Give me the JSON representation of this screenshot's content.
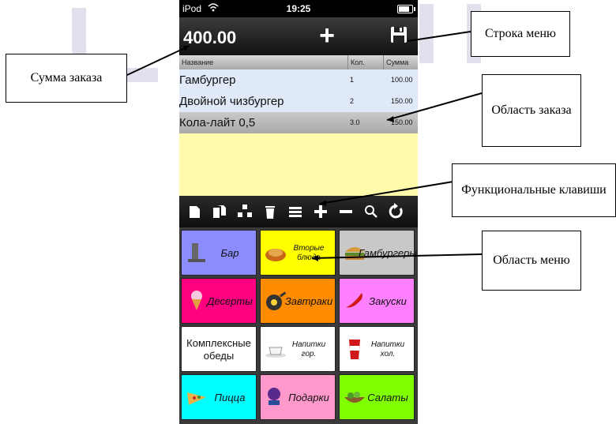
{
  "status_bar": {
    "carrier": "iPod",
    "time": "19:25",
    "battery_level": 0.8
  },
  "header": {
    "order_total": "400.00"
  },
  "order_table": {
    "columns": [
      "Название",
      "Кол.",
      "Сумма"
    ],
    "rows": [
      {
        "name": "Гамбургер",
        "qty": "1",
        "sum": "100.00",
        "selected": false
      },
      {
        "name": "Двойной чизбургер",
        "qty": "2",
        "sum": "150.00",
        "selected": false
      },
      {
        "name": "Кола-лайт 0,5",
        "qty": "3.0",
        "sum": "150.00",
        "selected": true
      }
    ]
  },
  "function_keys": [
    "new-document-icon",
    "copy-document-icon",
    "split-icon",
    "trash-icon",
    "list-icon",
    "plus-icon",
    "minus-icon",
    "search-icon",
    "refresh-icon"
  ],
  "menu": [
    {
      "label": "Бар",
      "color": "#8c8cff",
      "icon": "bar-icon"
    },
    {
      "label": "Вторые блюда",
      "color": "#ffff00",
      "icon": "main-dish-icon"
    },
    {
      "label": "Гамбургеры",
      "color": "#c8c8c8",
      "icon": "burger-icon"
    },
    {
      "label": "Десерты",
      "color": "#ff0080",
      "icon": "dessert-icon"
    },
    {
      "label": "Завтраки",
      "color": "#ff8c00",
      "icon": "breakfast-icon"
    },
    {
      "label": "Закуски",
      "color": "#ff80ff",
      "icon": "snack-icon"
    },
    {
      "label": "Комплексные обеды",
      "color": "#ffffff",
      "icon": ""
    },
    {
      "label": "Напитки гор.",
      "color": "#ffffff",
      "icon": "hot-drink-icon"
    },
    {
      "label": "Напитки хол.",
      "color": "#ffffff",
      "icon": "cold-drink-icon"
    },
    {
      "label": "Пицца",
      "color": "#00ffff",
      "icon": "pizza-icon"
    },
    {
      "label": "Подарки",
      "color": "#ff99cc",
      "icon": "gift-icon"
    },
    {
      "label": "Салаты",
      "color": "#80ff00",
      "icon": "salad-icon"
    }
  ],
  "callouts": {
    "order_sum": "Сумма заказа",
    "menu_bar": "Строка меню",
    "order_area": "Область заказа",
    "function_keys": "Функциональные клавиши",
    "menu_area": "Область меню"
  }
}
